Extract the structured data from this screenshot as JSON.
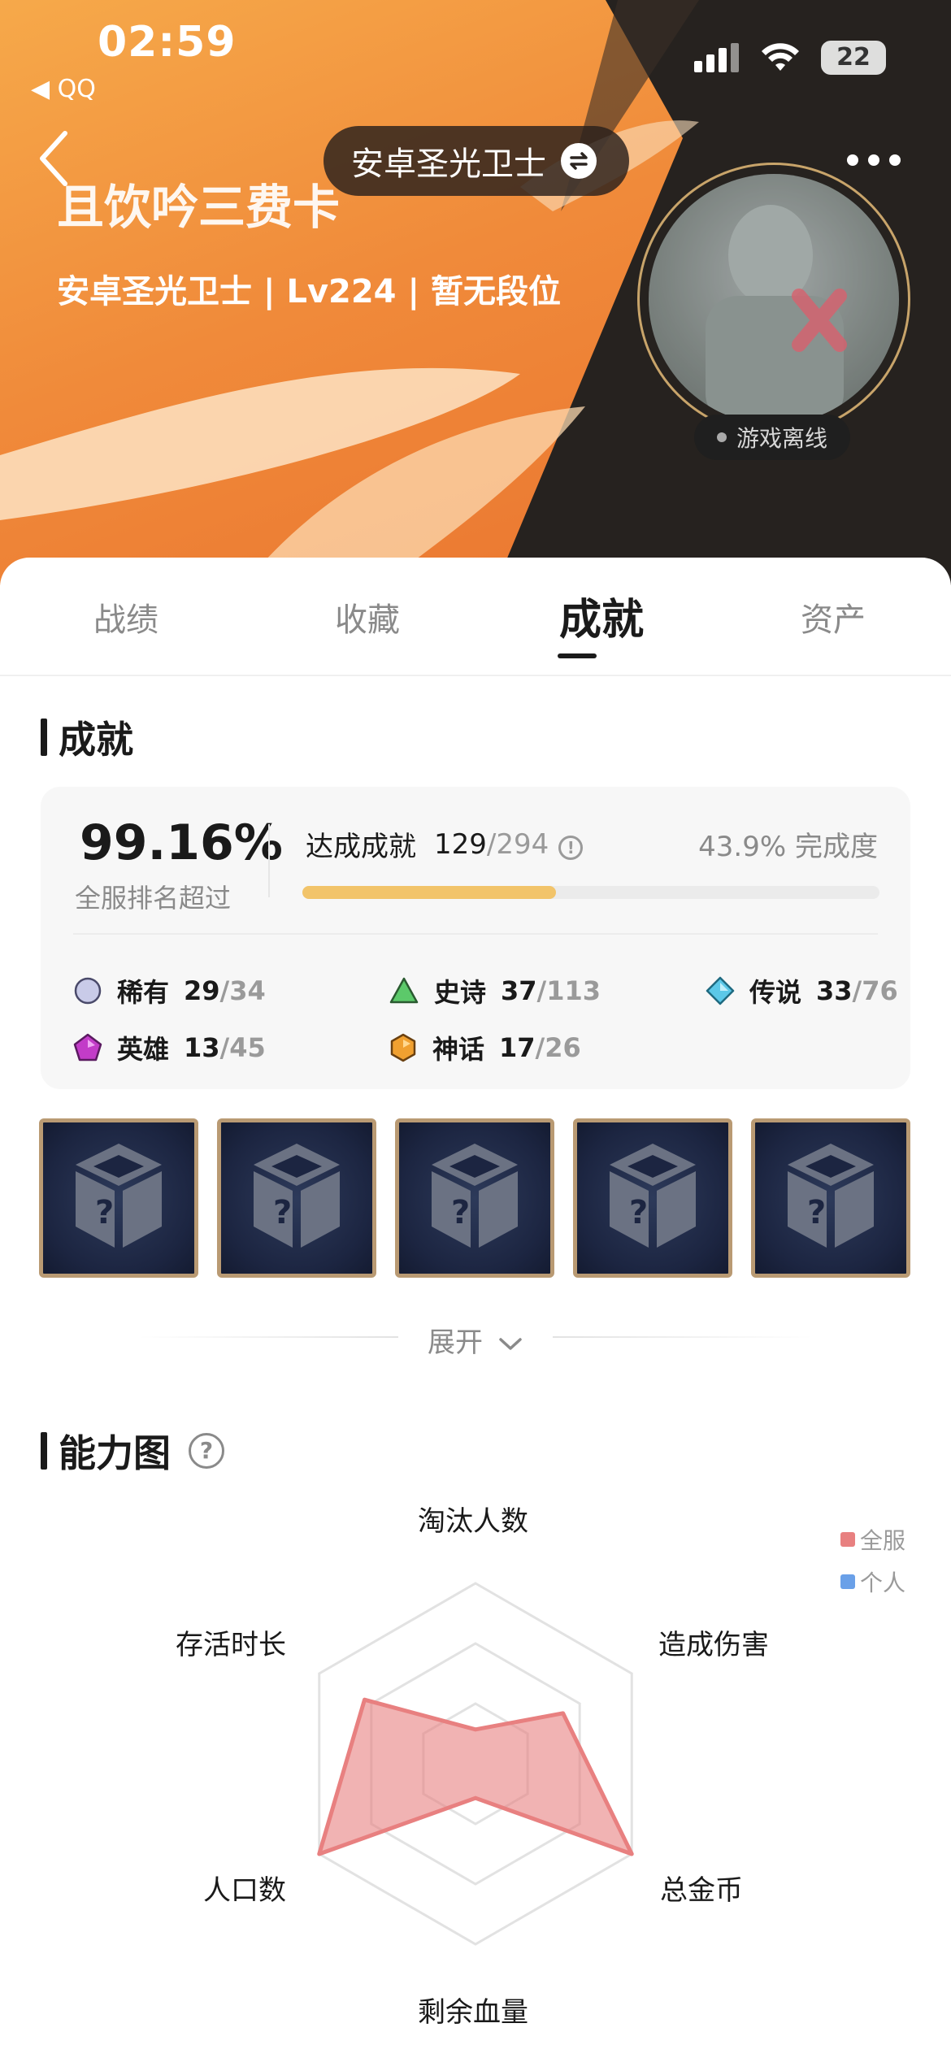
{
  "status_bar": {
    "time": "02:59",
    "back_app": "◀ QQ",
    "battery": "22"
  },
  "header": {
    "game_switch_label": "安卓圣光卫士",
    "player_name": "且饮吟三费卡",
    "player_subline": "安卓圣光卫士 | Lv224 | 暂无段位",
    "online_status": "游戏离线"
  },
  "tabs": [
    {
      "label": "战绩",
      "active": false
    },
    {
      "label": "收藏",
      "active": false
    },
    {
      "label": "成就",
      "active": true
    },
    {
      "label": "资产",
      "active": false
    }
  ],
  "achievements": {
    "section_title": "成就",
    "rank_percent": "99.16%",
    "rank_label": "全服排名超过",
    "reached_label": "达成成就",
    "reached_count": "129",
    "reached_total": "/294",
    "completion_text": "43.9% 完成度",
    "completion_fraction": 0.439,
    "rarities": [
      {
        "name": "稀有",
        "count": "29",
        "total": "/34",
        "color": "#c9cbe8",
        "shape": "circle"
      },
      {
        "name": "史诗",
        "count": "37",
        "total": "/113",
        "color": "#5cc96a",
        "shape": "triangle"
      },
      {
        "name": "传说",
        "count": "33",
        "total": "/76",
        "color": "#5cc8e8",
        "shape": "diamond"
      },
      {
        "name": "英雄",
        "count": "13",
        "total": "/45",
        "color": "#c23cc8",
        "shape": "pentagon"
      },
      {
        "name": "神话",
        "count": "17",
        "total": "/26",
        "color": "#f0a030",
        "shape": "hexagon"
      }
    ],
    "tiles_count": 5,
    "expand_label": "展开"
  },
  "ability_chart": {
    "section_title": "能力图",
    "legend": [
      {
        "label": "全服",
        "color": "#e88080"
      },
      {
        "label": "个人",
        "color": "#6aa0e8"
      }
    ],
    "axes": [
      "淘汰人数",
      "造成伤害",
      "总金币",
      "剩余血量",
      "人口数",
      "存活时长"
    ]
  },
  "chart_data": {
    "type": "radar",
    "axes": [
      "淘汰人数",
      "造成伤害",
      "总金币",
      "剩余血量",
      "人口数",
      "存活时长"
    ],
    "range": [
      0,
      1
    ],
    "grid_levels": 3,
    "series": [
      {
        "name": "全服",
        "values": [
          0.19,
          0.56,
          1.0,
          0.19,
          1.0,
          0.71
        ]
      }
    ]
  }
}
